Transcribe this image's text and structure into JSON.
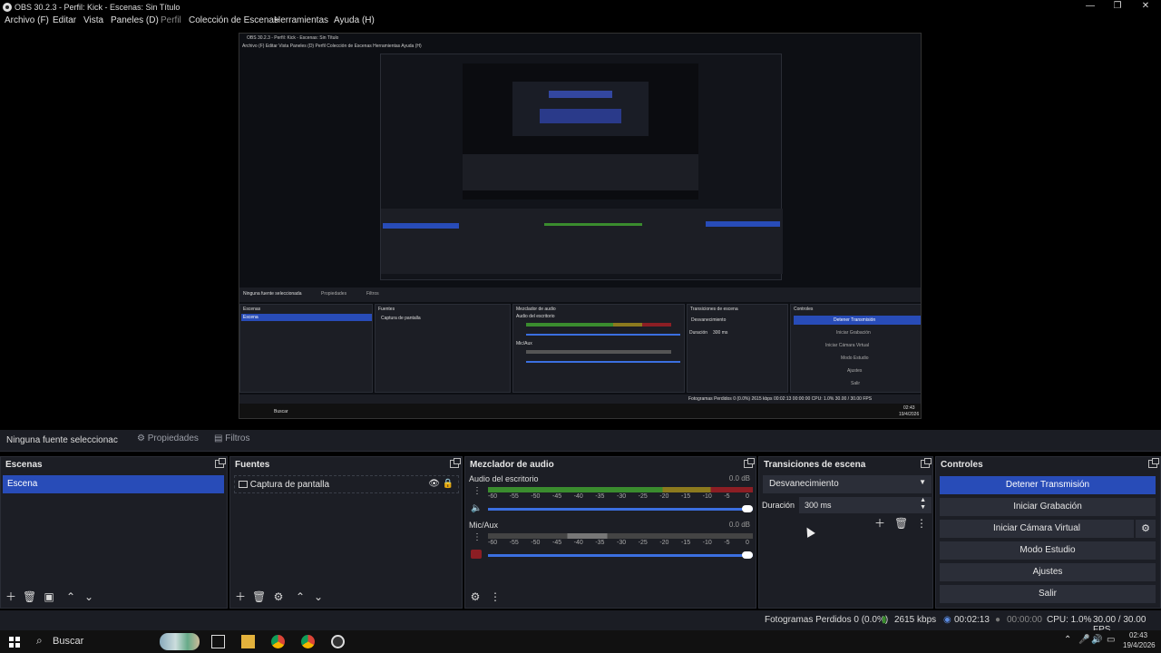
{
  "window": {
    "title": "OBS 30.2.3 - Perfil: Kick - Escenas: Sin Título",
    "controls": {
      "minimize": "—",
      "maximize": "❐",
      "close": "✕"
    }
  },
  "menu": {
    "items": [
      {
        "label": "Archivo (F)",
        "enabled": true
      },
      {
        "label": "Editar",
        "enabled": true
      },
      {
        "label": "Vista",
        "enabled": true
      },
      {
        "label": "Paneles (D)",
        "enabled": true
      },
      {
        "label": "Perfil",
        "enabled": false
      },
      {
        "label": "Colección de Escenas",
        "enabled": true
      },
      {
        "label": "Herramientas",
        "enabled": true
      },
      {
        "label": "Ayuda (H)",
        "enabled": true
      }
    ]
  },
  "source_bar": {
    "no_source": "Ninguna fuente seleccionac",
    "properties": "Propiedades",
    "filters": "Filtros"
  },
  "scenes": {
    "title": "Escenas",
    "items": [
      "Escena"
    ]
  },
  "sources": {
    "title": "Fuentes",
    "items": [
      "Captura de pantalla"
    ]
  },
  "mixer": {
    "title": "Mezclador de audio",
    "channels": [
      {
        "name": "Audio del escritorio",
        "db": "0.0 dB",
        "muted": false
      },
      {
        "name": "Mic/Aux",
        "db": "0.0 dB",
        "muted": true
      }
    ],
    "ticks": [
      "-60",
      "-55",
      "-50",
      "-45",
      "-40",
      "-35",
      "-30",
      "-25",
      "-20",
      "-15",
      "-10",
      "-5",
      "0"
    ]
  },
  "transitions": {
    "title": "Transiciones de escena",
    "selected": "Desvanecimiento",
    "duration_label": "Duración",
    "duration_value": "300 ms"
  },
  "controls": {
    "title": "Controles",
    "stop_stream": "Detener Transmisión",
    "start_recording": "Iniciar Grabación",
    "virtual_cam": "Iniciar Cámara Virtual",
    "studio_mode": "Modo Estudio",
    "settings": "Ajustes",
    "exit": "Salir"
  },
  "status": {
    "dropped": "Fotogramas Perdidos 0 (0.0%)",
    "bitrate": "2615 kbps",
    "stream_time": "00:02:13",
    "rec_time": "00:00:00",
    "cpu": "CPU: 1.0%",
    "fps": "30.00 / 30.00 FPS"
  },
  "taskbar": {
    "search": "Buscar",
    "time": "02:43",
    "date": "19/4/2026"
  },
  "nested_preview": {
    "title": "OBS 30.2.3 - Perfil: Kick - Escenas: Sin Título",
    "menu": "Archivo (F)   Editar   Vista   Paneles (D)   Perfil   Colección de Escenas   Herramientas   Ayuda (H)",
    "no_source": "Ninguna fuente seleccionada",
    "properties": "Propiedades",
    "filters": "Filtros",
    "scenes": "Escenas",
    "scene_item": "Escena",
    "sources": "Fuentes",
    "source_item": "Captura de pantalla",
    "mixer": "Mezclador de audio",
    "desktop_audio": "Audio del escritorio",
    "mic": "Mic/Aux",
    "transitions": "Transiciones de escena",
    "fade": "Desvanecimiento",
    "duration": "Duración",
    "duration_value": "300 ms",
    "controls": "Controles",
    "stop": "Detener Transmisión",
    "rec": "Iniciar Grabación",
    "vcam": "Iniciar Cámara Virtual",
    "studio": "Modo Estudio",
    "settings": "Ajustes",
    "exit": "Salir",
    "status": "Fotogramas Perdidos 0 (0.0%)   2615 kbps   00:02:13   00:00:00   CPU: 1.0%   30.00 / 30.00 FPS",
    "search": "Buscar",
    "time": "02:43",
    "date": "19/4/2026"
  },
  "colors": {
    "accent": "#284cb8",
    "panel": "#1c1e25",
    "meter_green": "#3a8c2e",
    "meter_yellow": "#8c7a1e",
    "meter_red": "#8c1e24",
    "slider": "#3b6fe0"
  }
}
